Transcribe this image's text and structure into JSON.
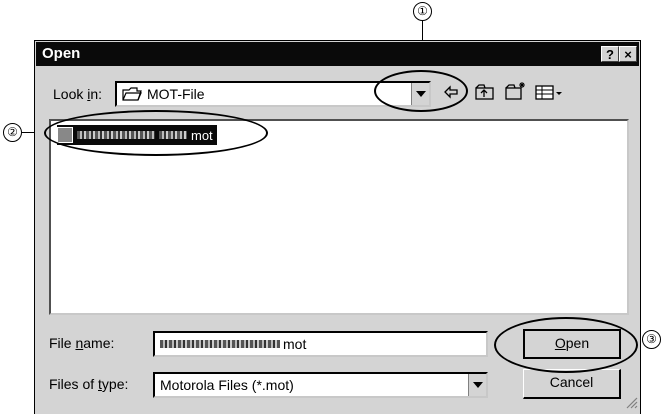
{
  "callouts": {
    "c1": "①",
    "c2": "②",
    "c3": "③"
  },
  "dialog": {
    "title": "Open",
    "help_label": "?",
    "close_label": "×",
    "lookin": {
      "label_pre": "Look ",
      "label_acc": "i",
      "label_post": "n:",
      "value": "MOT-File"
    },
    "files": [
      {
        "name_suffix": "mot"
      }
    ],
    "filename": {
      "label_pre": "File ",
      "label_acc": "n",
      "label_post": "ame:",
      "value_suffix": "mot"
    },
    "filetype": {
      "label_pre": "Files of ",
      "label_acc": "t",
      "label_post": "ype:",
      "value": "Motorola Files (*.mot)"
    },
    "open_button": {
      "acc": "O",
      "rest": "pen"
    },
    "cancel_button": "Cancel"
  },
  "icons": {
    "folder": "folder-icon",
    "back": "back-arrow-icon",
    "up": "up-folder-icon",
    "newfolder": "new-folder-icon",
    "view": "view-menu-icon",
    "file": "mot-file-icon"
  }
}
